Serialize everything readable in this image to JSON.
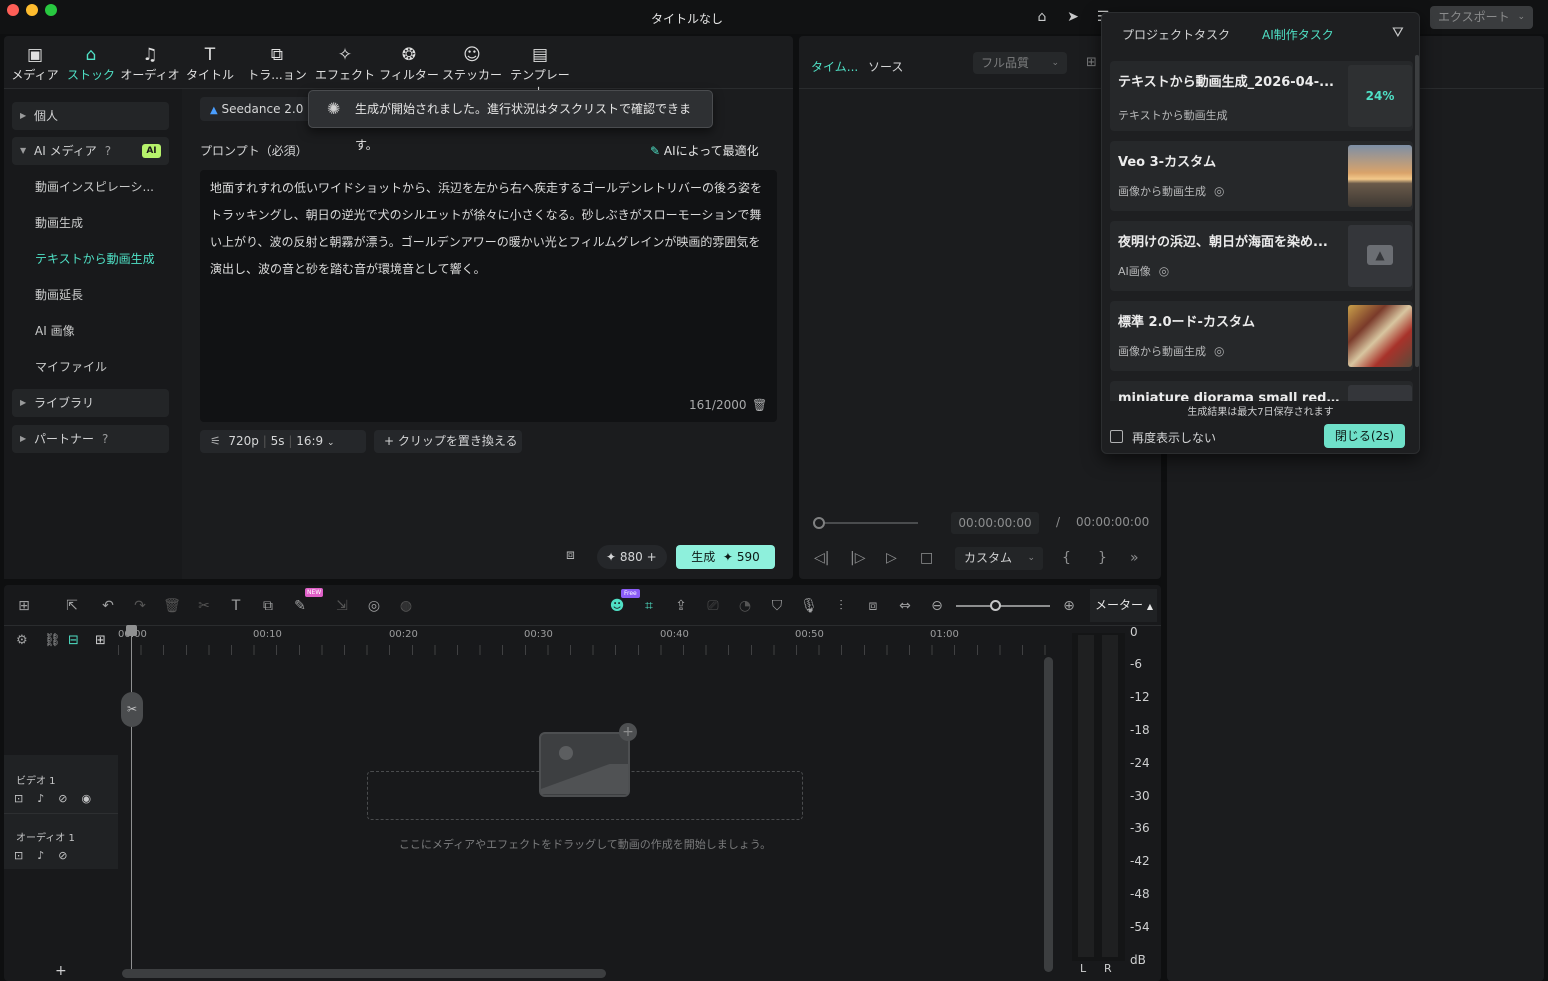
{
  "window": {
    "title": "タイトルなし",
    "export_label": "エクスポート"
  },
  "media_tabs": [
    {
      "label": "メディア",
      "icon": "media-icon"
    },
    {
      "label": "ストック",
      "icon": "stock-icon"
    },
    {
      "label": "オーディオ",
      "icon": "audio-icon"
    },
    {
      "label": "タイトル",
      "icon": "title-icon"
    },
    {
      "label": "トラ...ョン",
      "icon": "transition-icon"
    },
    {
      "label": "エフェクト",
      "icon": "effect-icon"
    },
    {
      "label": "フィルター",
      "icon": "filter-icon"
    },
    {
      "label": "ステッカー",
      "icon": "sticker-icon"
    },
    {
      "label": "テンプレート",
      "icon": "template-icon"
    }
  ],
  "sidebar": {
    "personal": "個人",
    "ai_media": "AI メディア",
    "ai_badge": "AI",
    "sub_items": [
      "動画インスピレーシ...",
      "動画生成",
      "テキストから動画生成",
      "動画延長",
      "AI 画像",
      "マイファイル"
    ],
    "library": "ライブラリ",
    "partner": "パートナー"
  },
  "generator": {
    "model": "Seedance 2.0",
    "toast": "生成が開始されました。進行状況はタスクリストで確認できます。",
    "prompt_label": "プロンプト（必須）",
    "optimize_label": "AIによって最適化",
    "prompt_text": "地面すれすれの低いワイドショットから、浜辺を左から右へ疾走するゴールデンレトリバーの後ろ姿をトラッキングし、朝日の逆光で犬のシルエットが徐々に小さくなる。砂しぶきがスローモーションで舞い上がり、波の反射と朝霧が漂う。ゴールデンアワーの暖かい光とフィルムグレインが映画的雰囲気を演出し、波の音と砂を踏む音が環境音として響く。",
    "char_count": "161/2000",
    "resolution": "720p",
    "duration": "5s",
    "aspect": "16:9",
    "replace_clip": "クリップを置き換える",
    "credits": "880",
    "generate_label": "生成",
    "generate_cost": "590"
  },
  "preview": {
    "tab_timeline": "タイム...",
    "tab_source": "ソース",
    "quality": "フル品質",
    "time_current": "00:00:00:00",
    "time_sep": "/",
    "time_total": "00:00:00:00",
    "zoom_mode": "カスタム"
  },
  "timeline": {
    "ruler": [
      "00:00",
      "00:10",
      "00:20",
      "00:30",
      "00:40",
      "00:50",
      "01:00"
    ],
    "track_video": "ビデオ 1",
    "track_audio": "オーディオ 1",
    "empty_hint": "ここにメディアやエフェクトをドラッグして動画の作成を開始しましょう。",
    "meter_label": "メーター",
    "meter_scale": [
      "0",
      "-6",
      "-12",
      "-18",
      "-24",
      "-30",
      "-36",
      "-42",
      "-48",
      "-54",
      "dB"
    ],
    "meter_l": "L",
    "meter_r": "R",
    "free_badge": "Free",
    "new_badge": "NEW"
  },
  "popup": {
    "tab_project": "プロジェクトタスク",
    "tab_ai": "AI制作タスク",
    "tasks": [
      {
        "title": "テキストから動画生成_2026-04-...",
        "sub": "テキストから動画生成",
        "progress": "24%"
      },
      {
        "title": "Veo 3-カスタム",
        "sub": "画像から動画生成"
      },
      {
        "title": "夜明けの浜辺、朝日が海面を染め...",
        "sub": "AI画像"
      },
      {
        "title": "標準 2.0ード-カスタム",
        "sub": "画像から動画生成"
      },
      {
        "title": "miniature diorama small red bus",
        "sub": ""
      }
    ],
    "retention_note": "生成結果は最大7日保存されます",
    "dont_show": "再度表示しない",
    "close_label": "閉じる(2s)"
  },
  "colors": {
    "accent": "#4fe0c5",
    "panel": "#1b1c1e",
    "button_bg": "#8ef0dc"
  }
}
